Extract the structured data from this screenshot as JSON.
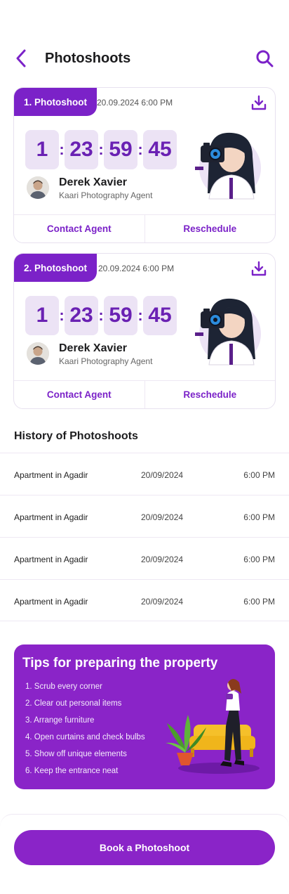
{
  "header": {
    "title": "Photoshoots",
    "back_icon": "chevron-left-icon",
    "search_icon": "search-icon"
  },
  "photoshoots": [
    {
      "tag": "1. Photoshoot",
      "datetime": "20.09.2024 6:00 PM",
      "countdown": {
        "days": "1",
        "hours": "23",
        "minutes": "59",
        "seconds": "45"
      },
      "agent": {
        "name": "Derek Xavier",
        "role": "Kaari Photography Agent"
      },
      "actions": {
        "contact": "Contact Agent",
        "reschedule": "Reschedule"
      }
    },
    {
      "tag": "2. Photoshoot",
      "datetime": "20.09.2024 6:00 PM",
      "countdown": {
        "days": "1",
        "hours": "23",
        "minutes": "59",
        "seconds": "45"
      },
      "agent": {
        "name": "Derek Xavier",
        "role": "Kaari Photography Agent"
      },
      "actions": {
        "contact": "Contact Agent",
        "reschedule": "Reschedule"
      }
    }
  ],
  "history": {
    "title": "History of Photoshoots",
    "rows": [
      {
        "name": "Apartment in Agadir",
        "date": "20/09/2024",
        "time": "6:00 PM"
      },
      {
        "name": "Apartment in Agadir",
        "date": "20/09/2024",
        "time": "6:00 PM"
      },
      {
        "name": "Apartment in Agadir",
        "date": "20/09/2024",
        "time": "6:00 PM"
      },
      {
        "name": "Apartment in Agadir",
        "date": "20/09/2024",
        "time": "6:00 PM"
      }
    ]
  },
  "tips": {
    "title": "Tips for preparing the property",
    "items": [
      "1. Scrub every corner",
      "2. Clear out personal items",
      "3. Arrange furniture",
      "4. Open curtains and check bulbs",
      "5. Show off unique elements",
      "6. Keep the entrance neat"
    ]
  },
  "cta": {
    "label": "Book a Photoshoot"
  },
  "colors": {
    "accent": "#8a24c8",
    "accent_dark": "#7b22c8",
    "countdown_bg": "#ece3f5",
    "countdown_text": "#6a21b3"
  }
}
